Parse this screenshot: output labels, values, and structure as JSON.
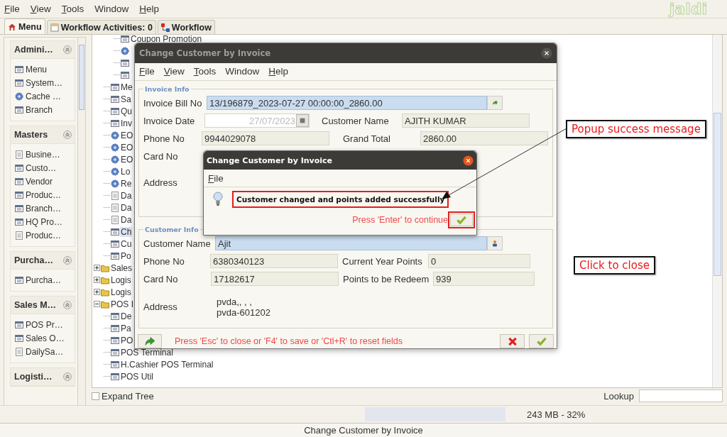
{
  "menu": [
    {
      "label": "File",
      "mnemonic": true
    },
    {
      "label": "View",
      "mnemonic": true
    },
    {
      "label": "Tools",
      "mnemonic": true
    },
    {
      "label": "Window",
      "mnemonic": false
    },
    {
      "label": "Help",
      "mnemonic": true
    }
  ],
  "logo": "jaldi",
  "tabs": [
    {
      "label": "Menu",
      "selected": true
    },
    {
      "label": "Workflow Activities: 0",
      "selected": false
    },
    {
      "label": "Workflow",
      "selected": false
    }
  ],
  "sidebar": {
    "groups": [
      {
        "title": "Admini…",
        "items": [
          {
            "label": "Menu",
            "kind": "doc"
          },
          {
            "label": "System…",
            "kind": "doc"
          },
          {
            "label": "Cache …",
            "kind": "gear"
          },
          {
            "label": "Branch",
            "kind": "doc"
          }
        ]
      },
      {
        "title": "Masters",
        "items": [
          {
            "label": "Busine…",
            "kind": "page"
          },
          {
            "label": "Custo…",
            "kind": "doc"
          },
          {
            "label": "Vendor",
            "kind": "doc"
          },
          {
            "label": "Produc…",
            "kind": "doc"
          },
          {
            "label": "Branch…",
            "kind": "doc"
          },
          {
            "label": "HQ Pro…",
            "kind": "doc"
          },
          {
            "label": "Produc…",
            "kind": "page"
          }
        ]
      },
      {
        "title": "Purcha…",
        "items": [
          {
            "label": "Purcha…",
            "kind": "doc"
          }
        ]
      },
      {
        "title": "Sales M…",
        "items": [
          {
            "label": "POS Pr…",
            "kind": "doc"
          },
          {
            "label": "Sales O…",
            "kind": "doc"
          },
          {
            "label": "DailySa…",
            "kind": "page"
          }
        ]
      },
      {
        "title": "Logisti…"
      }
    ]
  },
  "tree": {
    "items": [
      {
        "children": [
          {
            "children": [
              {
                "label": "Coupon Promotion",
                "kind": "doc",
                "selected": false
              },
              {
                "kind": "gear"
              },
              {
                "kind": "doc"
              },
              {
                "kind": "doc"
              }
            ]
          },
          {
            "label": "Me",
            "kind": "doc",
            "selected": false
          },
          {
            "label": "Sa",
            "kind": "doc",
            "selected": false
          },
          {
            "label": "Qu",
            "kind": "doc",
            "selected": false
          },
          {
            "label": "Inv",
            "kind": "doc",
            "selected": false
          },
          {
            "label": "EO",
            "kind": "gear",
            "selected": false
          },
          {
            "label": "EO",
            "kind": "gear",
            "selected": false
          },
          {
            "label": "EO",
            "kind": "gear",
            "selected": false
          },
          {
            "label": "Lo",
            "kind": "gear",
            "selected": false
          },
          {
            "label": "Re",
            "kind": "gear",
            "selected": false
          },
          {
            "label": "Da",
            "kind": "page",
            "selected": false
          },
          {
            "label": "Da",
            "kind": "page",
            "selected": false
          },
          {
            "label": "Da",
            "kind": "page",
            "selected": false
          },
          {
            "label": "Ch",
            "kind": "doc",
            "selected": true
          },
          {
            "label": "Cu",
            "kind": "doc",
            "selected": false
          },
          {
            "label": "Po",
            "kind": "doc",
            "selected": false
          }
        ]
      },
      {
        "label": "Sales",
        "kind": "folder",
        "expanded": false,
        "selected": false
      },
      {
        "label": "Logis",
        "kind": "folder",
        "expanded": false,
        "selected": false
      },
      {
        "label": "Logis",
        "kind": "folder",
        "expanded": false,
        "selected": false
      },
      {
        "label": "POS I",
        "kind": "folder",
        "expanded": true,
        "selected": false,
        "children": [
          {
            "label": "De",
            "kind": "doc",
            "selected": false
          },
          {
            "label": "Pa",
            "kind": "doc",
            "selected": false
          },
          {
            "label": "PO",
            "kind": "doc",
            "selected": false
          },
          {
            "label": "POS Terminal",
            "kind": "doc",
            "selected": false
          },
          {
            "label": "H.Cashier POS Terminal",
            "kind": "doc",
            "selected": false
          },
          {
            "label": "POS Util",
            "kind": "doc",
            "selected": false
          }
        ]
      }
    ]
  },
  "expand_tree": {
    "label": "Expand Tree",
    "checked": false
  },
  "lookup": {
    "label": "Lookup"
  },
  "memory": "243 MB - 32%",
  "status": "Change Customer by Invoice",
  "dialog": {
    "title": "Change Customer by Invoice",
    "menu": [
      {
        "label": "File",
        "mnemonic": true
      },
      {
        "label": "View",
        "mnemonic": true
      },
      {
        "label": "Tools",
        "mnemonic": true
      },
      {
        "label": "Window",
        "mnemonic": false
      },
      {
        "label": "Help",
        "mnemonic": true
      }
    ],
    "invoice_info": {
      "legend": "Invoice Info",
      "bill_no": {
        "label": "Invoice Bill No",
        "value": "13/196879_2023-07-27 00:00:00_2860.00"
      },
      "date": {
        "label": "Invoice Date",
        "value": "27/07/2023",
        "disabled": true
      },
      "customer_name": {
        "label": "Customer Name",
        "value": "AJITH KUMAR"
      },
      "phone": {
        "label": "Phone No",
        "value": "9944029078"
      },
      "grand_total": {
        "label": "Grand Total",
        "value": "2860.00"
      },
      "card_no": {
        "label": "Card No"
      },
      "address": {
        "label": "Address"
      }
    },
    "customer_info": {
      "legend": "Customer Info",
      "customer_name": {
        "label": "Customer Name",
        "value": "Ajit"
      },
      "phone": {
        "label": "Phone No",
        "value": "6380340123"
      },
      "points": {
        "label": "Current Year Points",
        "value": "0"
      },
      "card_no": {
        "label": "Card No",
        "value": "17182617"
      },
      "redeem": {
        "label": "Points to be Redeem",
        "value": "939"
      },
      "address": {
        "label": "Address",
        "lines": [
          "pvda,, , ,",
          "pvda-601202"
        ]
      }
    },
    "hint": "Press 'Esc' to close or 'F4' to save or 'Ctl+R' to reset fields"
  },
  "popup": {
    "title": "Change Customer by Invoice",
    "menu": [
      {
        "label": "File",
        "mnemonic": true
      }
    ],
    "message": "Customer changed and points added successfully",
    "hint": "Press 'Enter' to continue"
  },
  "annotations": [
    {
      "text": "Popup success message",
      "kind": "arrow"
    },
    {
      "text": "Click to close",
      "kind": "plain"
    }
  ]
}
